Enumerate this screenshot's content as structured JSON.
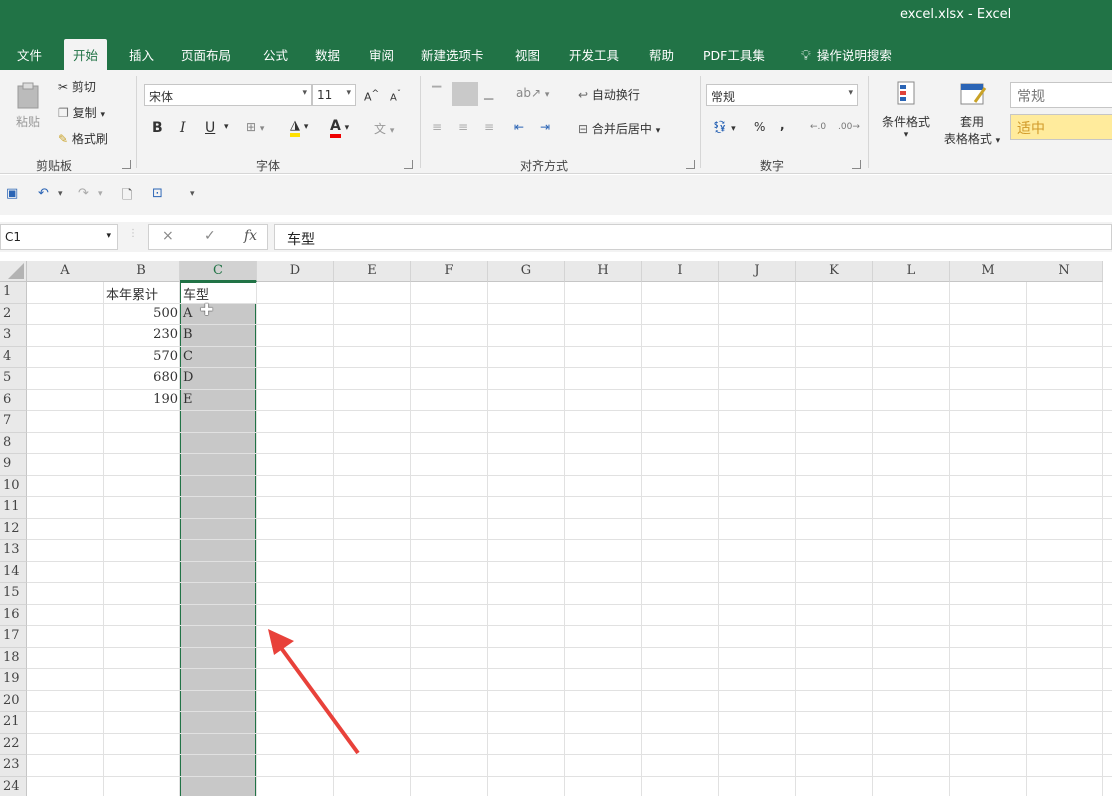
{
  "window": {
    "title": "excel.xlsx  -  Excel"
  },
  "tabs": [
    {
      "label": "文件",
      "active": false
    },
    {
      "label": "开始",
      "active": true
    },
    {
      "label": "插入",
      "active": false
    },
    {
      "label": "页面布局",
      "active": false
    },
    {
      "label": "公式",
      "active": false
    },
    {
      "label": "数据",
      "active": false
    },
    {
      "label": "审阅",
      "active": false
    },
    {
      "label": "新建选项卡",
      "active": false
    },
    {
      "label": "视图",
      "active": false
    },
    {
      "label": "开发工具",
      "active": false
    },
    {
      "label": "帮助",
      "active": false
    },
    {
      "label": "PDF工具集",
      "active": false
    },
    {
      "label": "操作说明搜索",
      "active": false,
      "icon": "lightbulb-icon"
    }
  ],
  "ribbon": {
    "clipboard": {
      "paste": "粘贴",
      "cut": "剪切",
      "copy": "复制",
      "painter": "格式刷",
      "label": "剪贴板"
    },
    "font": {
      "name": "宋体",
      "size": "11",
      "bold": "B",
      "italic": "I",
      "underline": "U",
      "label": "字体",
      "fontcolor": "A"
    },
    "alignment": {
      "wrap": "自动换行",
      "merge": "合并后居中",
      "label": "对齐方式"
    },
    "number": {
      "format": "常规",
      "percent": "%",
      "comma": ",",
      "label": "数字"
    },
    "styles": {
      "conditional": "条件格式",
      "table_line1": "套用",
      "table_line2": "表格格式",
      "style_normal": "常规",
      "style_neutral": "适中"
    }
  },
  "formula_bar": {
    "name_box": "C1",
    "cancel": "×",
    "enter": "✓",
    "fx": "fx",
    "content": "车型"
  },
  "grid": {
    "columns": [
      "A",
      "B",
      "C",
      "D",
      "E",
      "F",
      "G",
      "H",
      "I",
      "J",
      "K",
      "L",
      "M",
      "N"
    ],
    "selected_column": "C",
    "rows": [
      "1",
      "2",
      "3",
      "4",
      "5",
      "6",
      "7",
      "8",
      "9",
      "10",
      "11",
      "12",
      "13",
      "14",
      "15",
      "16",
      "17",
      "18",
      "19",
      "20",
      "21",
      "22",
      "23",
      "24"
    ],
    "B": [
      "本年累计",
      "500",
      "230",
      "570",
      "680",
      "190"
    ],
    "C": [
      "车型",
      "A",
      "B",
      "C",
      "D",
      "E"
    ]
  },
  "colors": {
    "accent": "#217346",
    "selection": "#c8c8c8",
    "arrow": "#e8413a"
  }
}
